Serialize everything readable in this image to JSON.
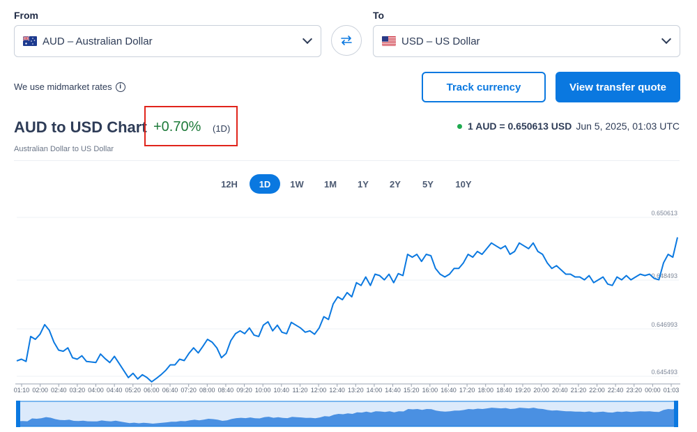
{
  "from": {
    "label": "From",
    "value": "AUD – Australian Dollar",
    "flag_icon": "australia-flag-icon"
  },
  "to": {
    "label": "To",
    "value": "USD – US Dollar",
    "flag_icon": "us-flag-icon"
  },
  "swap_icon": "swap-arrows-icon",
  "midmarket_note": "We use midmarket rates",
  "buttons": {
    "track": "Track currency",
    "quote": "View transfer quote"
  },
  "chart_header": {
    "title": "AUD to USD Chart",
    "change": "+0.70%",
    "change_period": "(1D)",
    "subtitle": "Australian Dollar to US Dollar",
    "rate_text": "1 AUD = 0.650613 USD",
    "rate_time": "Jun 5, 2025, 01:03 UTC"
  },
  "periods": [
    {
      "label": "12H",
      "active": false
    },
    {
      "label": "1D",
      "active": true
    },
    {
      "label": "1W",
      "active": false
    },
    {
      "label": "1M",
      "active": false
    },
    {
      "label": "1Y",
      "active": false
    },
    {
      "label": "2Y",
      "active": false
    },
    {
      "label": "5Y",
      "active": false
    },
    {
      "label": "10Y",
      "active": false
    }
  ],
  "colors": {
    "accent": "#0a78e0",
    "positive": "#1e7a3a",
    "highlight_box": "#e0241b",
    "live_dot": "#1eaa4f",
    "navigator_fill": "#4a90e2"
  },
  "chart_data": {
    "type": "line",
    "y_tick_labels": [
      "0.650613",
      "0.648493",
      "0.646993",
      "0.645493"
    ],
    "ylim": [
      0.645,
      0.651
    ],
    "x_tick_labels": [
      "01:10",
      "02:00",
      "02:40",
      "03:20",
      "04:00",
      "04:40",
      "05:20",
      "06:00",
      "06:40",
      "07:20",
      "08:00",
      "08:40",
      "09:20",
      "10:00",
      "10:40",
      "11:20",
      "12:00",
      "12:40",
      "13:20",
      "14:00",
      "14:40",
      "15:20",
      "16:00",
      "16:40",
      "17:20",
      "18:00",
      "18:40",
      "19:20",
      "20:00",
      "20:40",
      "21:20",
      "22:00",
      "22:40",
      "23:20",
      "00:00",
      "01:03"
    ],
    "series": [
      {
        "values": [
          0.64574,
          0.6458,
          0.64572,
          0.6466,
          0.6465,
          0.64668,
          0.64702,
          0.64682,
          0.6464,
          0.64612,
          0.64608,
          0.6462,
          0.64585,
          0.6458,
          0.64592,
          0.64572,
          0.6457,
          0.64568,
          0.64598,
          0.64582,
          0.64568,
          0.6459,
          0.64565,
          0.6454,
          0.64515,
          0.6453,
          0.6451,
          0.64525,
          0.64515,
          0.645,
          0.64512,
          0.64525,
          0.6454,
          0.6456,
          0.6456,
          0.6458,
          0.64575,
          0.646,
          0.6462,
          0.64602,
          0.64625,
          0.6465,
          0.6464,
          0.6462,
          0.64585,
          0.646,
          0.64645,
          0.6467,
          0.6468,
          0.6467,
          0.6469,
          0.64665,
          0.6466,
          0.647,
          0.64712,
          0.6468,
          0.647,
          0.64675,
          0.6467,
          0.6471,
          0.647,
          0.6469,
          0.64675,
          0.6468,
          0.64668,
          0.6469,
          0.6473,
          0.6472,
          0.64775,
          0.648,
          0.6479,
          0.64815,
          0.648,
          0.6485,
          0.6484,
          0.6487,
          0.6484,
          0.6488,
          0.64875,
          0.6486,
          0.6488,
          0.6485,
          0.64882,
          0.64875,
          0.6495,
          0.6494,
          0.6495,
          0.64925,
          0.6495,
          0.64945,
          0.649,
          0.6488,
          0.6487,
          0.6488,
          0.649,
          0.649,
          0.6492,
          0.6495,
          0.6494,
          0.6496,
          0.6495,
          0.6497,
          0.6499,
          0.6498,
          0.6497,
          0.6498,
          0.6495,
          0.6496,
          0.6499,
          0.6498,
          0.6497,
          0.6499,
          0.6496,
          0.6495,
          0.6492,
          0.649,
          0.6491,
          0.64895,
          0.6488,
          0.6488,
          0.6487,
          0.6487,
          0.6486,
          0.64875,
          0.6485,
          0.6486,
          0.6487,
          0.64845,
          0.6484,
          0.6487,
          0.6486,
          0.64875,
          0.6486,
          0.6487,
          0.6488,
          0.64875,
          0.6488,
          0.64865,
          0.6486,
          0.6492,
          0.6495,
          0.6494,
          0.6501
        ]
      }
    ],
    "grid": true,
    "legend": "none"
  }
}
